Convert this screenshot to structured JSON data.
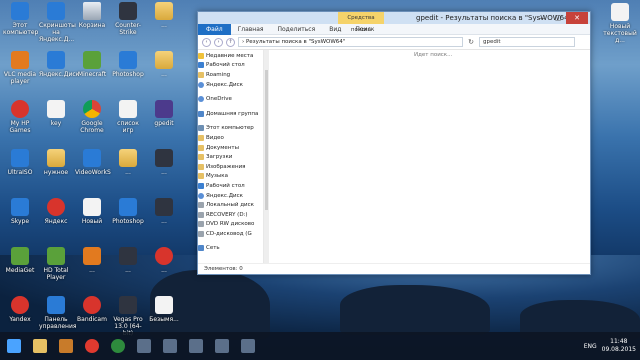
{
  "desktop_left": [
    {
      "label": "Этот компьютер",
      "icon": "computer-icon",
      "cls": "blue"
    },
    {
      "label": "Скриншоты на Яндекс.Д...",
      "icon": "folder-icon",
      "cls": "blue"
    },
    {
      "label": "Корзина",
      "icon": "recycle-bin-icon",
      "cls": "bin"
    },
    {
      "label": "Counter-Strike",
      "icon": "cs-icon",
      "cls": "dark"
    },
    {
      "label": "...",
      "icon": "folder-icon",
      "cls": "folder"
    },
    {
      "label": "VLC media player",
      "icon": "vlc-icon",
      "cls": "orange"
    },
    {
      "label": "Яндекс.Диск",
      "icon": "yandex-disk-icon",
      "cls": "blue"
    },
    {
      "label": "Minecraft",
      "icon": "minecraft-icon",
      "cls": "green"
    },
    {
      "label": "Photoshop",
      "icon": "photoshop-icon",
      "cls": "blue"
    },
    {
      "label": "...",
      "icon": "folder-icon",
      "cls": "folder"
    },
    {
      "label": "My HP Games",
      "icon": "hp-games-icon",
      "cls": "red"
    },
    {
      "label": "key",
      "icon": "key-file-icon",
      "cls": "doc"
    },
    {
      "label": "Google Chrome",
      "icon": "chrome-icon",
      "cls": "chrome"
    },
    {
      "label": "список игр",
      "icon": "text-file-icon",
      "cls": "doc"
    },
    {
      "label": "gpedit",
      "icon": "archive-icon",
      "cls": "purple"
    },
    {
      "label": "UltraISO",
      "icon": "ultraiso-icon",
      "cls": "blue"
    },
    {
      "label": "нужное",
      "icon": "folder-icon",
      "cls": "folder"
    },
    {
      "label": "VideoWorkS",
      "icon": "video-icon",
      "cls": "blue"
    },
    {
      "label": "...",
      "icon": "folder-icon",
      "cls": "folder"
    },
    {
      "label": "...",
      "icon": "app-icon",
      "cls": "dark"
    },
    {
      "label": "Skype",
      "icon": "skype-icon",
      "cls": "blue"
    },
    {
      "label": "Яндекс",
      "icon": "yandex-icon",
      "cls": "red"
    },
    {
      "label": "Новый",
      "icon": "file-icon",
      "cls": "doc"
    },
    {
      "label": "Photoshop",
      "icon": "photoshop-icon",
      "cls": "blue"
    },
    {
      "label": "...",
      "icon": "app-icon",
      "cls": "dark"
    },
    {
      "label": "MediaGet",
      "icon": "mediaget-icon",
      "cls": "green"
    },
    {
      "label": "HD Total Player",
      "icon": "player-icon",
      "cls": "green"
    },
    {
      "label": "...",
      "icon": "app-icon",
      "cls": "orange"
    },
    {
      "label": "...",
      "icon": "app-icon",
      "cls": "dark"
    },
    {
      "label": "...",
      "icon": "app-icon",
      "cls": "red"
    },
    {
      "label": "Yandex",
      "icon": "yandex-browser-icon",
      "cls": "red"
    },
    {
      "label": "Панель управления",
      "icon": "control-panel-icon",
      "cls": "blue"
    },
    {
      "label": "Bandicam",
      "icon": "bandicam-icon",
      "cls": "red"
    },
    {
      "label": "Vegas Pro 13.0 (64-bit)",
      "icon": "vegas-icon",
      "cls": "dark"
    },
    {
      "label": "Безымя...",
      "icon": "file-icon",
      "cls": "doc"
    }
  ],
  "desktop_right": {
    "label": "Новый текстовый д...",
    "icon": "text-file-icon"
  },
  "window": {
    "context_tab": "Средства поиска",
    "title": "gpedit - Результаты поиска в \"SysWOW64\"",
    "minimize": "—",
    "maximize": "▢",
    "close": "✕",
    "tabs": [
      "Файл",
      "Главная",
      "Поделиться",
      "Вид",
      "Поиск"
    ],
    "back": "‹",
    "forward": "›",
    "up": "↑",
    "path": "›  Результаты поиска в \"SysWOW64\"",
    "refresh": "↻",
    "search_value": "gpedit",
    "searching": "Идет поиск...",
    "status": "Элементов: 0"
  },
  "nav": [
    {
      "label": "Недавние места",
      "cls": "star"
    },
    {
      "label": "Рабочий стол",
      "cls": "blue"
    },
    {
      "label": "Roaming",
      "cls": ""
    },
    {
      "label": "Яндекс.Диск",
      "cls": "cloud"
    },
    {
      "label": "OneDrive",
      "cls": "cloud",
      "gap": true
    },
    {
      "label": "Домашняя группа",
      "cls": "net",
      "gap": true
    },
    {
      "label": "Этот компьютер",
      "cls": "pc",
      "gap": true
    },
    {
      "label": "Видео",
      "cls": ""
    },
    {
      "label": "Документы",
      "cls": ""
    },
    {
      "label": "Загрузки",
      "cls": ""
    },
    {
      "label": "Изображения",
      "cls": ""
    },
    {
      "label": "Музыка",
      "cls": ""
    },
    {
      "label": "Рабочий стол",
      "cls": "blue"
    },
    {
      "label": "Яндекс.Диск",
      "cls": "cloud"
    },
    {
      "label": "Локальный диск",
      "cls": "drive"
    },
    {
      "label": "RECOVERY (D:)",
      "cls": "drive"
    },
    {
      "label": "DVD RW дисково",
      "cls": "drive"
    },
    {
      "label": "CD-дисковод (G",
      "cls": "drive"
    },
    {
      "label": "Сеть",
      "cls": "net",
      "gap": true
    }
  ],
  "taskbar": {
    "icons": [
      "start-icon",
      "file-explorer-icon",
      "game-icon",
      "yandex-browser-icon",
      "chrome-icon",
      "app-icon",
      "app-icon",
      "app-icon",
      "app-icon",
      "app-icon"
    ],
    "lang": "ENG",
    "time": "11:48",
    "date": "09.08.2015"
  }
}
